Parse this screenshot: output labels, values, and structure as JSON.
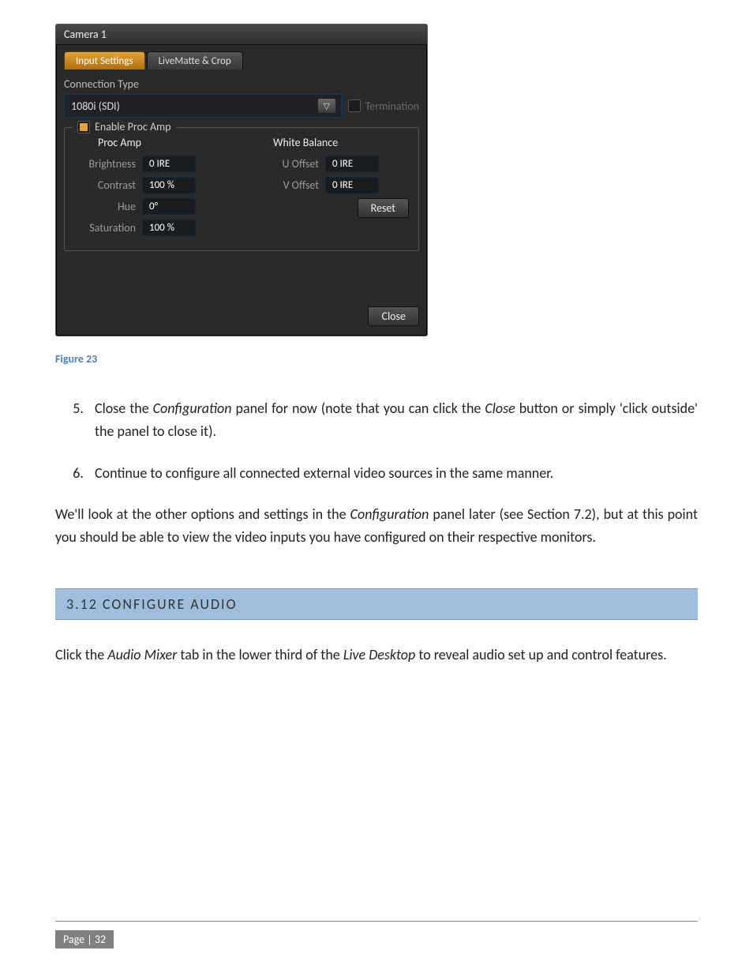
{
  "figure": {
    "caption": "Figure 23",
    "panel_title": "Camera 1",
    "tabs": [
      {
        "label": "Input Settings",
        "active": true
      },
      {
        "label": "LiveMatte & Crop",
        "active": false
      }
    ],
    "connection_label": "Connection Type",
    "connection_value": "1080i (SDI)",
    "termination_label": "Termination",
    "group_title": "Enable Proc Amp",
    "procamp_head": "Proc Amp",
    "whitebal_head": "White Balance",
    "procamp": {
      "brightness_label": "Brightness",
      "brightness_value": "0 IRE",
      "contrast_label": "Contrast",
      "contrast_value": "100 %",
      "hue_label": "Hue",
      "hue_value": "0°",
      "saturation_label": "Saturation",
      "saturation_value": "100 %"
    },
    "whitebal": {
      "u_label": "U Offset",
      "u_value": "0 IRE",
      "v_label": "V Offset",
      "v_value": "0 IRE"
    },
    "reset_label": "Reset",
    "close_label": "Close"
  },
  "body": {
    "li5_a": "Close the ",
    "li5_em1": "Configuration",
    "li5_b": " panel for now (note that you can click the ",
    "li5_em2": "Close",
    "li5_c": " button or simply 'click outside' the panel to close it).",
    "li6": "Continue to configure all connected external video sources in the same manner.",
    "para_a": "We'll look at the other options and settings in the ",
    "para_em": "Configuration",
    "para_b": " panel later (see Section 7.2), but at this point you should be able to view the video inputs you have configured on their respective monitors."
  },
  "section_heading": "3.12  CONFIGURE AUDIO",
  "section_para_a": "Click the ",
  "section_para_em1": "Audio Mixer",
  "section_para_b": " tab in the lower third of the ",
  "section_para_em2": "Live Desktop",
  "section_para_c": " to reveal audio set up and control features.",
  "page_number": "Page | 32"
}
